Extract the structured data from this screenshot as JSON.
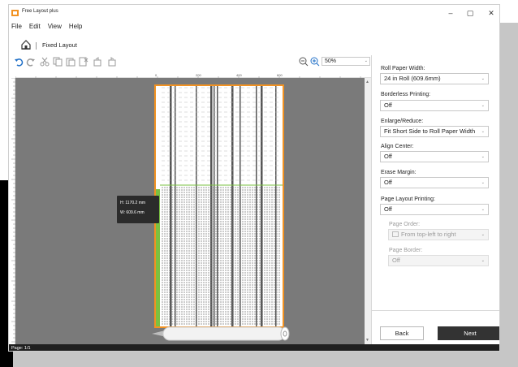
{
  "app": {
    "title": "Free Layout plus"
  },
  "window_controls": {
    "minimize": "–",
    "maximize": "▢",
    "close": "✕"
  },
  "menu": [
    "File",
    "Edit",
    "View",
    "Help"
  ],
  "mode": {
    "label": "Fixed Layout"
  },
  "toolbar": {
    "zoom_value": "50%"
  },
  "ruler": {
    "ticks": [
      "0",
      "200",
      "400",
      "600"
    ]
  },
  "preview": {
    "height_label": "H: 1170.2 mm",
    "width_label": "W: 609.6 mm"
  },
  "panel": {
    "roll_paper_width": {
      "label": "Roll Paper Width:",
      "value": "24 in Roll (609.6mm)"
    },
    "borderless": {
      "label": "Borderless Printing:",
      "value": "Off"
    },
    "enlarge": {
      "label": "Enlarge/Reduce:",
      "value": "Fit Short Side to Roll Paper Width"
    },
    "align_center": {
      "label": "Align Center:",
      "value": "Off"
    },
    "erase_margin": {
      "label": "Erase Margin:",
      "value": "Off"
    },
    "page_layout": {
      "label": "Page Layout Printing:",
      "value": "Off"
    },
    "page_order": {
      "label": "Page Order:",
      "value": "From top-left to right"
    },
    "page_border": {
      "label": "Page Border:",
      "value": "Off"
    }
  },
  "buttons": {
    "back": "Back",
    "next": "Next"
  },
  "status": {
    "page": "Page: 1/1"
  },
  "colors": {
    "accent_orange": "#f29222",
    "accent_green": "#7ac142",
    "canvas": "#7a7a7a",
    "next_button": "#333333"
  }
}
